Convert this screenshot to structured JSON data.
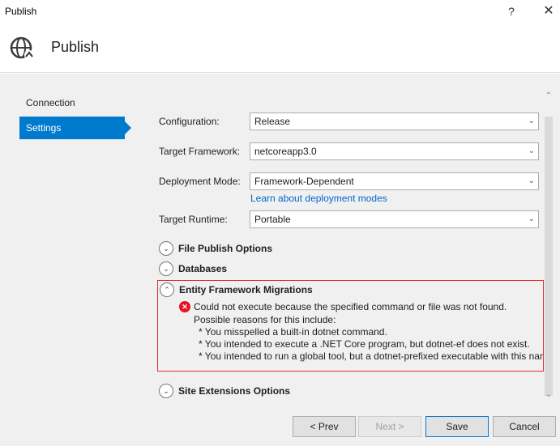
{
  "window": {
    "title": "Publish",
    "help_glyph": "?",
    "close_glyph": "✕"
  },
  "header": {
    "title": "Publish",
    "icon": "globe-publish-icon"
  },
  "nav": {
    "items": [
      {
        "label": "Connection"
      },
      {
        "label": "Settings",
        "selected": true
      }
    ]
  },
  "form": {
    "configuration": {
      "label": "Configuration:",
      "value": "Release"
    },
    "target_framework": {
      "label": "Target Framework:",
      "value": "netcoreapp3.0"
    },
    "deployment_mode": {
      "label": "Deployment Mode:",
      "value": "Framework-Dependent",
      "link": "Learn about deployment modes"
    },
    "target_runtime": {
      "label": "Target Runtime:",
      "value": "Portable"
    }
  },
  "sections": {
    "file_publish": {
      "title": "File Publish Options",
      "expanded": false
    },
    "databases": {
      "title": "Databases",
      "expanded": false
    },
    "ef_migrations": {
      "title": "Entity Framework Migrations",
      "expanded": true,
      "error_lines": [
        "Could not execute because the specified command or file was not found.",
        "Possible reasons for this include:",
        "* You misspelled a built-in dotnet command.",
        "* You intended to execute a .NET Core program, but dotnet-ef does not exist.",
        "* You intended to run a global tool, but a dotnet-prefixed executable with this name could not be found on the PATH."
      ]
    },
    "site_extensions": {
      "title": "Site Extensions Options",
      "expanded": false
    }
  },
  "buttons": {
    "prev": "< Prev",
    "next": "Next >",
    "save": "Save",
    "cancel": "Cancel"
  },
  "colors": {
    "accent": "#007acc",
    "error": "#e81123",
    "link": "#0066cc"
  }
}
